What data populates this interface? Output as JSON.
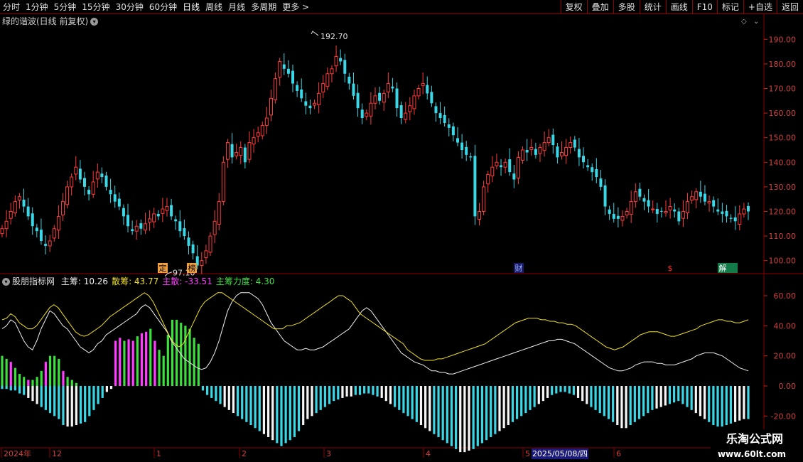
{
  "toolbar": {
    "left": [
      "分时",
      "1分钟",
      "5分钟",
      "15分钟",
      "30分钟",
      "60分钟",
      "日线",
      "周线",
      "月线",
      "多周期",
      "更多 >"
    ],
    "active": "日线",
    "right": [
      "复权",
      "叠加",
      "多股",
      "统计",
      "画线",
      "F10",
      "标记",
      "+自选",
      "返回"
    ]
  },
  "header": {
    "title": "绿的谐波(日线 前复权)",
    "chevron": "chevron-down-icon"
  },
  "main": {
    "y_ticks": [
      "190.00",
      "180.00",
      "170.00",
      "160.00",
      "150.00",
      "140.00",
      "130.00",
      "120.00",
      "110.00",
      "100.00"
    ],
    "high_label": "192.70",
    "low_label": "97.10",
    "badges": [
      {
        "text": "定",
        "bg": "#f2a03c",
        "fg": "#000000"
      },
      {
        "text": "榜",
        "bg": "#f2a03c",
        "fg": "#000000"
      },
      {
        "text": "财",
        "bg": "#1a1a6a",
        "fg": "#9fb4ff"
      },
      {
        "text": "$",
        "bg": "#000000",
        "fg": "#ff3030"
      },
      {
        "text": "解",
        "bg": "#137a4a",
        "fg": "#ffffff"
      }
    ]
  },
  "indicator": {
    "name": "股朋指标网",
    "legend": [
      {
        "label": "主筹: ",
        "value": "10.26",
        "color": "#f0f0f0"
      },
      {
        "label": "散筹: ",
        "value": "43.77",
        "color": "#f0e020"
      },
      {
        "label": "主散: ",
        "value": "-33.51",
        "color": "#ff3cff"
      },
      {
        "label": "主筹力度: ",
        "value": "4.30",
        "color": "#40e040"
      }
    ],
    "y_ticks": [
      "60.00",
      "40.00",
      "20.00",
      "0.00",
      "-20.00"
    ]
  },
  "timeline": {
    "labels": [
      "2024年",
      "12",
      "1",
      "2",
      "3",
      "4",
      "5",
      "6"
    ],
    "cursor_date": "2025/05/08/四"
  },
  "watermark": {
    "title": "乐淘公式网",
    "url": "www.60lt.com"
  },
  "chart_data": [
    {
      "type": "candlestick",
      "title": "绿的谐波(日线 前复权)",
      "ylim": [
        95,
        195
      ],
      "high": 192.7,
      "low": 97.1,
      "close_series": [
        113,
        116,
        120,
        124,
        126,
        122,
        118,
        114,
        112,
        108,
        106,
        108,
        113,
        118,
        124,
        130,
        134,
        138,
        133,
        130,
        127,
        132,
        136,
        134,
        130,
        127,
        124,
        122,
        118,
        114,
        112,
        114,
        113,
        115,
        117,
        119,
        118,
        121,
        122,
        118,
        116,
        112,
        110,
        106,
        103,
        98,
        100,
        104,
        110,
        116,
        124,
        140,
        148,
        142,
        144,
        146,
        140,
        148,
        150,
        152,
        155,
        158,
        166,
        174,
        181,
        178,
        176,
        172,
        169,
        166,
        163,
        162,
        164,
        168,
        172,
        176,
        178,
        183,
        181,
        176,
        172,
        167,
        162,
        158,
        160,
        164,
        167,
        165,
        168,
        172,
        170,
        162,
        158,
        160,
        163,
        167,
        170,
        172,
        168,
        164,
        160,
        158,
        156,
        154,
        151,
        148,
        145,
        143,
        142,
        118,
        120,
        130,
        135,
        138,
        140,
        138,
        140,
        136,
        133,
        142,
        145,
        144,
        146,
        143,
        146,
        148,
        150,
        147,
        142,
        144,
        146,
        148,
        146,
        142,
        140,
        138,
        136,
        134,
        130,
        122,
        119,
        117,
        117,
        118,
        120,
        124,
        128,
        126,
        124,
        122,
        121,
        119,
        120,
        120,
        122,
        120,
        116,
        120,
        124,
        126,
        128,
        126,
        124,
        124,
        122,
        120,
        119,
        118,
        117,
        116,
        119,
        121,
        120
      ],
      "x_labels": [
        "2024年",
        "12",
        "1",
        "2",
        "3",
        "4",
        "5",
        "6"
      ]
    },
    {
      "type": "bar+line",
      "title": "股朋指标网",
      "series": [
        {
          "name": "主筹",
          "values": [
            38,
            40,
            44,
            42,
            36,
            30,
            26,
            24,
            30,
            38,
            44,
            50,
            48,
            44,
            40,
            38,
            34,
            30,
            26,
            24,
            22,
            24,
            28,
            30,
            34,
            36,
            38,
            40,
            42,
            44,
            46,
            48,
            52,
            54,
            52,
            48,
            44,
            40,
            36,
            30,
            26,
            22,
            18,
            16,
            14,
            12,
            11,
            12,
            16,
            22,
            30,
            40,
            50,
            56,
            60,
            62,
            62,
            62,
            60,
            58,
            54,
            48,
            42,
            38,
            34,
            30,
            28,
            26,
            24,
            24,
            25,
            24,
            24,
            25,
            26,
            28,
            30,
            32,
            34,
            36,
            38,
            42,
            46,
            50,
            52,
            50,
            46,
            42,
            38,
            34,
            30,
            26,
            22,
            20,
            18,
            16,
            15,
            14,
            12,
            10,
            10,
            9,
            9,
            8,
            8,
            9,
            10,
            11,
            12,
            13,
            14,
            15,
            16,
            17,
            18,
            19,
            20,
            21,
            22,
            23,
            24,
            25,
            26,
            27,
            28,
            29,
            30,
            30,
            31,
            31,
            30,
            29,
            28,
            26,
            24,
            22,
            20,
            18,
            16,
            14,
            12,
            11,
            10,
            10,
            11,
            12,
            14,
            15,
            16,
            16,
            16,
            15,
            15,
            14,
            14,
            14,
            15,
            16,
            17,
            18,
            20,
            21,
            22,
            22,
            22,
            21,
            20,
            18,
            16,
            14,
            12,
            11,
            10
          ],
          "color": "#f0f0f0"
        },
        {
          "name": "散筹",
          "values": [
            44,
            45,
            48,
            46,
            42,
            40,
            38,
            38,
            40,
            44,
            48,
            52,
            54,
            52,
            48,
            44,
            40,
            36,
            34,
            33,
            34,
            36,
            38,
            40,
            43,
            46,
            48,
            50,
            52,
            54,
            56,
            58,
            60,
            62,
            60,
            56,
            50,
            44,
            38,
            32,
            28,
            26,
            28,
            34,
            40,
            46,
            52,
            56,
            58,
            60,
            62,
            62,
            60,
            58,
            56,
            54,
            52,
            50,
            48,
            46,
            44,
            42,
            40,
            38,
            38,
            38,
            40,
            40,
            41,
            42,
            44,
            46,
            48,
            50,
            52,
            54,
            56,
            58,
            60,
            60,
            58,
            56,
            52,
            48,
            46,
            44,
            42,
            40,
            38,
            36,
            34,
            32,
            30,
            28,
            24,
            22,
            20,
            18,
            17,
            17,
            17,
            18,
            18,
            19,
            20,
            21,
            22,
            23,
            24,
            25,
            26,
            27,
            28,
            30,
            32,
            34,
            36,
            38,
            40,
            42,
            43,
            44,
            45,
            45,
            45,
            44,
            44,
            43,
            43,
            42,
            42,
            41,
            41,
            40,
            38,
            36,
            34,
            32,
            30,
            28,
            26,
            25,
            24,
            25,
            26,
            28,
            30,
            32,
            34,
            35,
            36,
            36,
            36,
            35,
            34,
            33,
            33,
            34,
            35,
            36,
            37,
            38,
            40,
            41,
            42,
            43,
            44,
            44,
            43,
            43,
            42,
            42,
            43,
            44
          ],
          "color": "#f0e020"
        },
        {
          "name": "主散",
          "values": [
            -2,
            -2,
            -3,
            -3,
            -5,
            -6,
            -8,
            -10,
            -12,
            -14,
            -16,
            -18,
            -20,
            -22,
            -26,
            -27,
            -27,
            -26,
            -25,
            -24,
            -20,
            -16,
            -12,
            -8,
            -4,
            -2,
            30,
            32,
            30,
            31,
            30,
            33,
            35,
            36,
            38,
            30,
            24,
            20,
            34,
            44,
            44,
            42,
            40,
            38,
            32,
            28,
            -3,
            -6,
            -8,
            -10,
            -12,
            -14,
            -16,
            -18,
            -20,
            -22,
            -24,
            -26,
            -28,
            -30,
            -32,
            -34,
            -36,
            -38,
            -40,
            -38,
            -36,
            -34,
            -30,
            -26,
            -22,
            -20,
            -18,
            -16,
            -14,
            -12,
            -10,
            -9,
            -8,
            -7,
            -7,
            -6,
            -6,
            -5,
            -5,
            -6,
            -7,
            -8,
            -10,
            -12,
            -14,
            -16,
            -18,
            -20,
            -22,
            -24,
            -26,
            -28,
            -30,
            -32,
            -34,
            -36,
            -38,
            -40,
            -42,
            -44,
            -44,
            -43,
            -42,
            -40,
            -38,
            -36,
            -34,
            -32,
            -30,
            -28,
            -26,
            -24,
            -22,
            -20,
            -18,
            -16,
            -14,
            -12,
            -10,
            -8,
            -6,
            -5,
            -4,
            -4,
            -5,
            -6,
            -8,
            -10,
            -12,
            -14,
            -16,
            -18,
            -20,
            -22,
            -24,
            -26,
            -28,
            -28,
            -26,
            -24,
            -22,
            -20,
            -18,
            -16,
            -15,
            -14,
            -13,
            -12,
            -11,
            -10,
            -12,
            -14,
            -16,
            -18,
            -20,
            -22,
            -24,
            -26,
            -27,
            -27,
            -26,
            -25,
            -24,
            -23,
            -22,
            -22
          ],
          "color": "#ff3cff"
        },
        {
          "name": "主筹力度",
          "values": [
            20,
            18,
            16,
            12,
            8,
            6,
            4,
            4,
            6,
            10,
            16,
            20,
            20,
            18,
            10,
            6,
            4,
            2,
            0,
            0
          ],
          "color": "#40e040"
        }
      ],
      "ylim": [
        -30,
        70
      ]
    }
  ]
}
